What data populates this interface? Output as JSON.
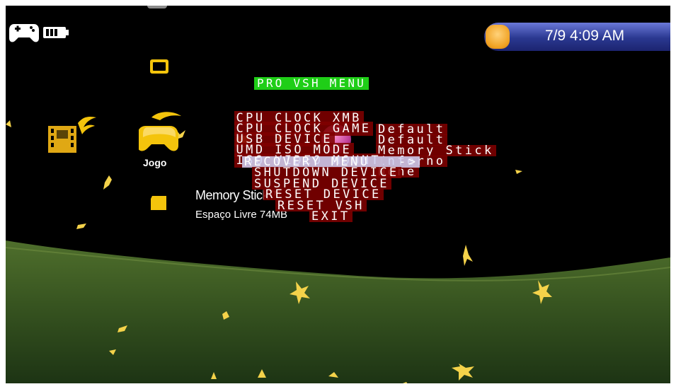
{
  "status_bar": {
    "datetime": "7/9 4:09 AM",
    "icons": [
      "gamepad-icon",
      "battery-icon",
      "clock-knob-icon"
    ]
  },
  "xmb": {
    "columns": [
      {
        "name": "video-icon"
      },
      {
        "name": "game-icon",
        "label": "Jogo"
      }
    ],
    "game_items": [
      "umd-icon",
      "memory-stick-icon"
    ],
    "storage": {
      "name": "Memory Stick™",
      "free_space": "Espaço Livre  74MB"
    }
  },
  "vsh_menu": {
    "title": "PRO VSH MENU",
    "settings": [
      {
        "label": "CPU CLOCK XMB",
        "value": "Default"
      },
      {
        "label": "CPU CLOCK GAME",
        "value": "Default"
      },
      {
        "label": "USB DEVICE",
        "value": "Memory Stick"
      },
      {
        "label": "UMD ISO MODE",
        "value": "Inferno"
      },
      {
        "label": "ISO VIDEO MOUNT",
        "value": "None"
      }
    ],
    "selected_action": "RECOVERY MENU   ->",
    "actions": [
      "SHUTDOWN DEVICE",
      "SUSPEND DEVICE",
      "RESET DEVICE",
      "RESET VSH",
      "EXIT"
    ]
  },
  "colors": {
    "title_bg": "#1fce17",
    "row_bg": "#800000",
    "selected_bg": "#cecef0",
    "xmb_icon": "#f4c40c",
    "hill": "#3c5a1e"
  }
}
